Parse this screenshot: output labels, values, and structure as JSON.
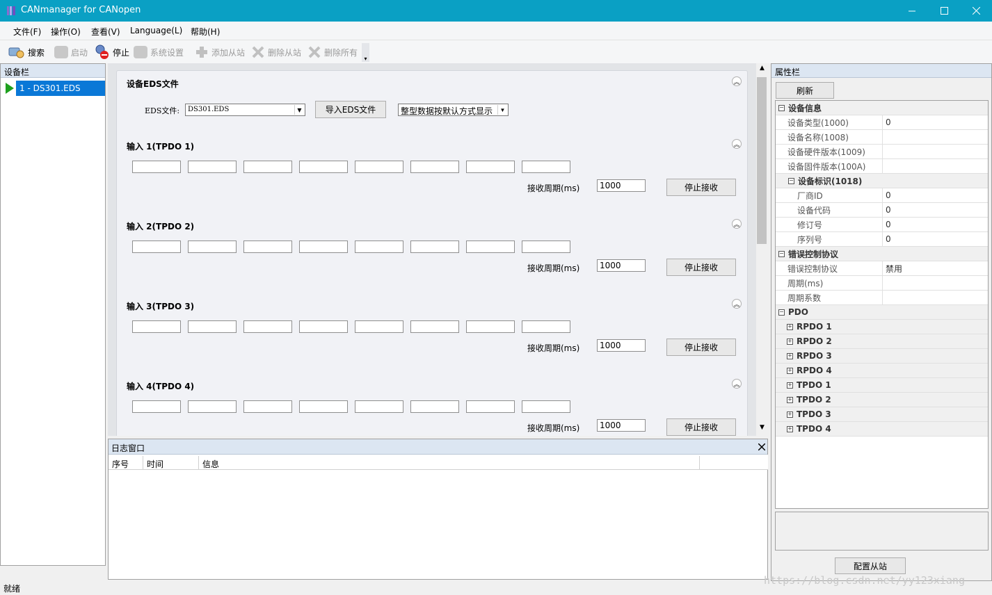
{
  "window": {
    "title": "CANmanager for CANopen"
  },
  "menu": [
    "文件(F)",
    "操作(O)",
    "查看(V)",
    "Language(L)",
    "帮助(H)"
  ],
  "toolbar": {
    "search": "搜索",
    "start": "启动",
    "stop": "停止",
    "settings": "系统设置",
    "add_slave": "添加从站",
    "del_slave": "删除从站",
    "del_all": "删除所有"
  },
  "device_panel": {
    "title": "设备栏",
    "item": "1 - DS301.EDS"
  },
  "eds": {
    "section_title": "设备EDS文件",
    "label": "EDS文件:",
    "file": "DS301.EDS",
    "import_button": "导入EDS文件",
    "display_mode": "整型数据按默认方式显示"
  },
  "inputs": [
    {
      "title": "输入 1(TPDO 1)",
      "period_label": "接收周期(ms)",
      "period": "1000",
      "button": "停止接收"
    },
    {
      "title": "输入 2(TPDO 2)",
      "period_label": "接收周期(ms)",
      "period": "1000",
      "button": "停止接收"
    },
    {
      "title": "输入 3(TPDO 3)",
      "period_label": "接收周期(ms)",
      "period": "1000",
      "button": "停止接收"
    },
    {
      "title": "输入 4(TPDO 4)",
      "period_label": "接收周期(ms)",
      "period": "1000",
      "button": "停止接收"
    }
  ],
  "log": {
    "title": "日志窗口",
    "cols": [
      "序号",
      "时间",
      "信息"
    ]
  },
  "props": {
    "title": "属性栏",
    "refresh": "刷新",
    "configure": "配置从站",
    "dev_info": "设备信息",
    "dev_type": {
      "k": "设备类型(1000)",
      "v": "0"
    },
    "dev_name": {
      "k": "设备名称(1008)",
      "v": ""
    },
    "hw_ver": {
      "k": "设备硬件版本(1009)",
      "v": ""
    },
    "fw_ver": {
      "k": "设备固件版本(100A)",
      "v": ""
    },
    "ident": "设备标识(1018)",
    "vendor": {
      "k": "厂商ID",
      "v": "0"
    },
    "product": {
      "k": "设备代码",
      "v": "0"
    },
    "revision": {
      "k": "修订号",
      "v": "0"
    },
    "serial": {
      "k": "序列号",
      "v": "0"
    },
    "err_ctrl": "错误控制协议",
    "err_proto": {
      "k": "错误控制协议",
      "v": "禁用"
    },
    "period": {
      "k": "周期(ms)",
      "v": ""
    },
    "factor": {
      "k": "周期系数",
      "v": ""
    },
    "pdo": "PDO",
    "pdo_items": [
      "RPDO 1",
      "RPDO 2",
      "RPDO 3",
      "RPDO 4",
      "TPDO 1",
      "TPDO 2",
      "TPDO 3",
      "TPDO 4"
    ]
  },
  "status": "就绪",
  "watermark": "https://blog.csdn.net/yy123xiang"
}
